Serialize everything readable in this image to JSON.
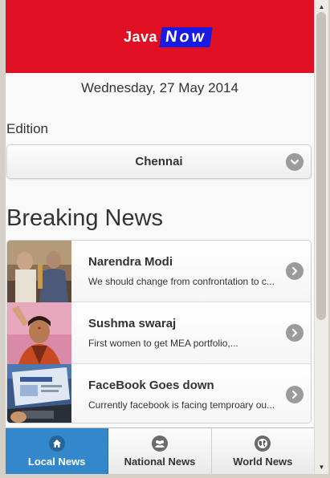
{
  "header": {
    "logo_part1": "Java",
    "logo_part2": "Now",
    "bg_color": "#e10f24"
  },
  "date": "Wednesday, 27 May 2014",
  "edition": {
    "label": "Edition",
    "selected": "Chennai",
    "icon": "chevron-down-icon"
  },
  "breaking_news": {
    "title": "Breaking News",
    "items": [
      {
        "title": "Narendra Modi",
        "desc": "We should change from confrontation to c...",
        "icon": "chevron-right-icon"
      },
      {
        "title": "Sushma swaraj",
        "desc": "First women to get MEA portfolio,...",
        "icon": "chevron-right-icon"
      },
      {
        "title": "FaceBook Goes down",
        "desc": "Currently facebook is facing temproary ou...",
        "icon": "chevron-right-icon"
      }
    ]
  },
  "navbar": {
    "tabs": [
      {
        "label": "Local News",
        "icon": "home-icon",
        "active": true
      },
      {
        "label": "National News",
        "icon": "group-icon",
        "active": false
      },
      {
        "label": "World News",
        "icon": "globe-icon",
        "active": false
      }
    ],
    "active_color": "#3388cc"
  },
  "scrollbar": {
    "up": "▲",
    "down": "▼"
  }
}
